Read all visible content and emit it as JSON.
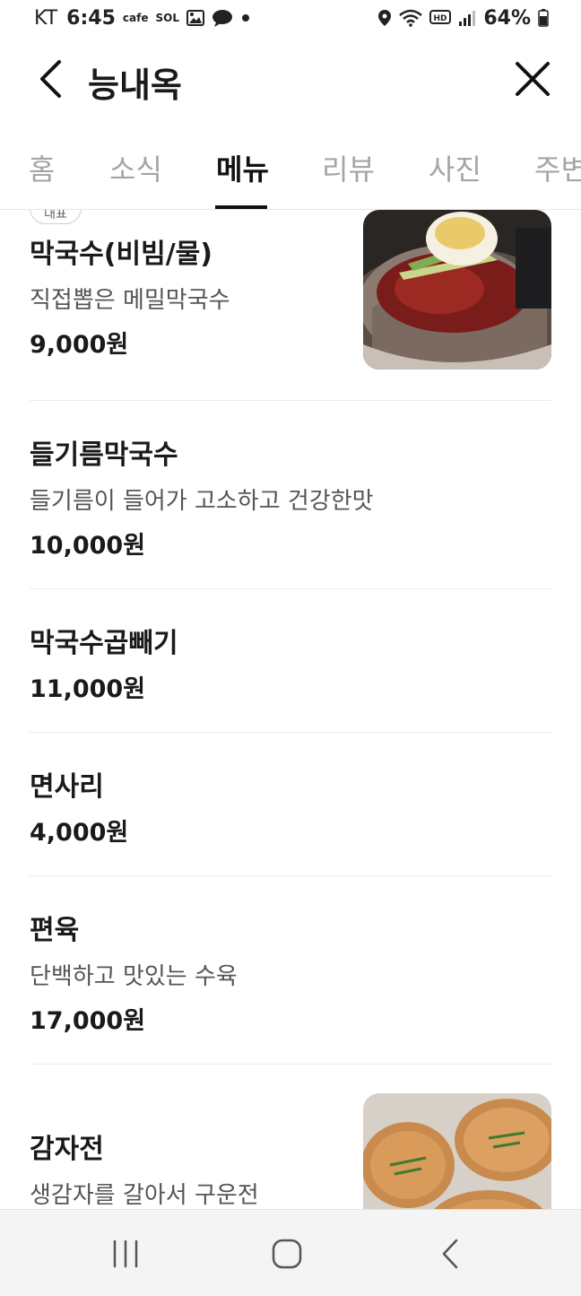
{
  "status_bar": {
    "carrier": "KT",
    "time": "6:45",
    "app_cafe": "cafe",
    "app_sol": "SOL",
    "battery": "64%"
  },
  "header": {
    "title": "능내옥"
  },
  "tabs": [
    {
      "label": "홈",
      "active": false
    },
    {
      "label": "소식",
      "active": false
    },
    {
      "label": "메뉴",
      "active": true
    },
    {
      "label": "리뷰",
      "active": false
    },
    {
      "label": "사진",
      "active": false
    },
    {
      "label": "주변",
      "active": false
    }
  ],
  "menu": {
    "badge": "대표",
    "items": [
      {
        "name": "막국수(비빔/물)",
        "desc": "직접뽑은 메밀막국수",
        "price": "9,000원"
      },
      {
        "name": "들기름막국수",
        "desc": "들기름이 들어가 고소하고 건강한맛",
        "price": "10,000원"
      },
      {
        "name": "막국수곱빼기",
        "price": "11,000원"
      },
      {
        "name": "면사리",
        "price": "4,000원"
      },
      {
        "name": "편육",
        "desc": "단백하고 맛있는 수육",
        "price": "17,000원"
      },
      {
        "name": "감자전",
        "desc": "생감자를 갈아서 구운전"
      }
    ]
  },
  "colors": {
    "accent_text": "#111111",
    "inactive_tab": "#a5a5a5",
    "divider": "#ececec"
  },
  "icons": [
    "back-icon",
    "close-icon",
    "recent-apps-icon",
    "home-icon",
    "nav-back-icon"
  ]
}
